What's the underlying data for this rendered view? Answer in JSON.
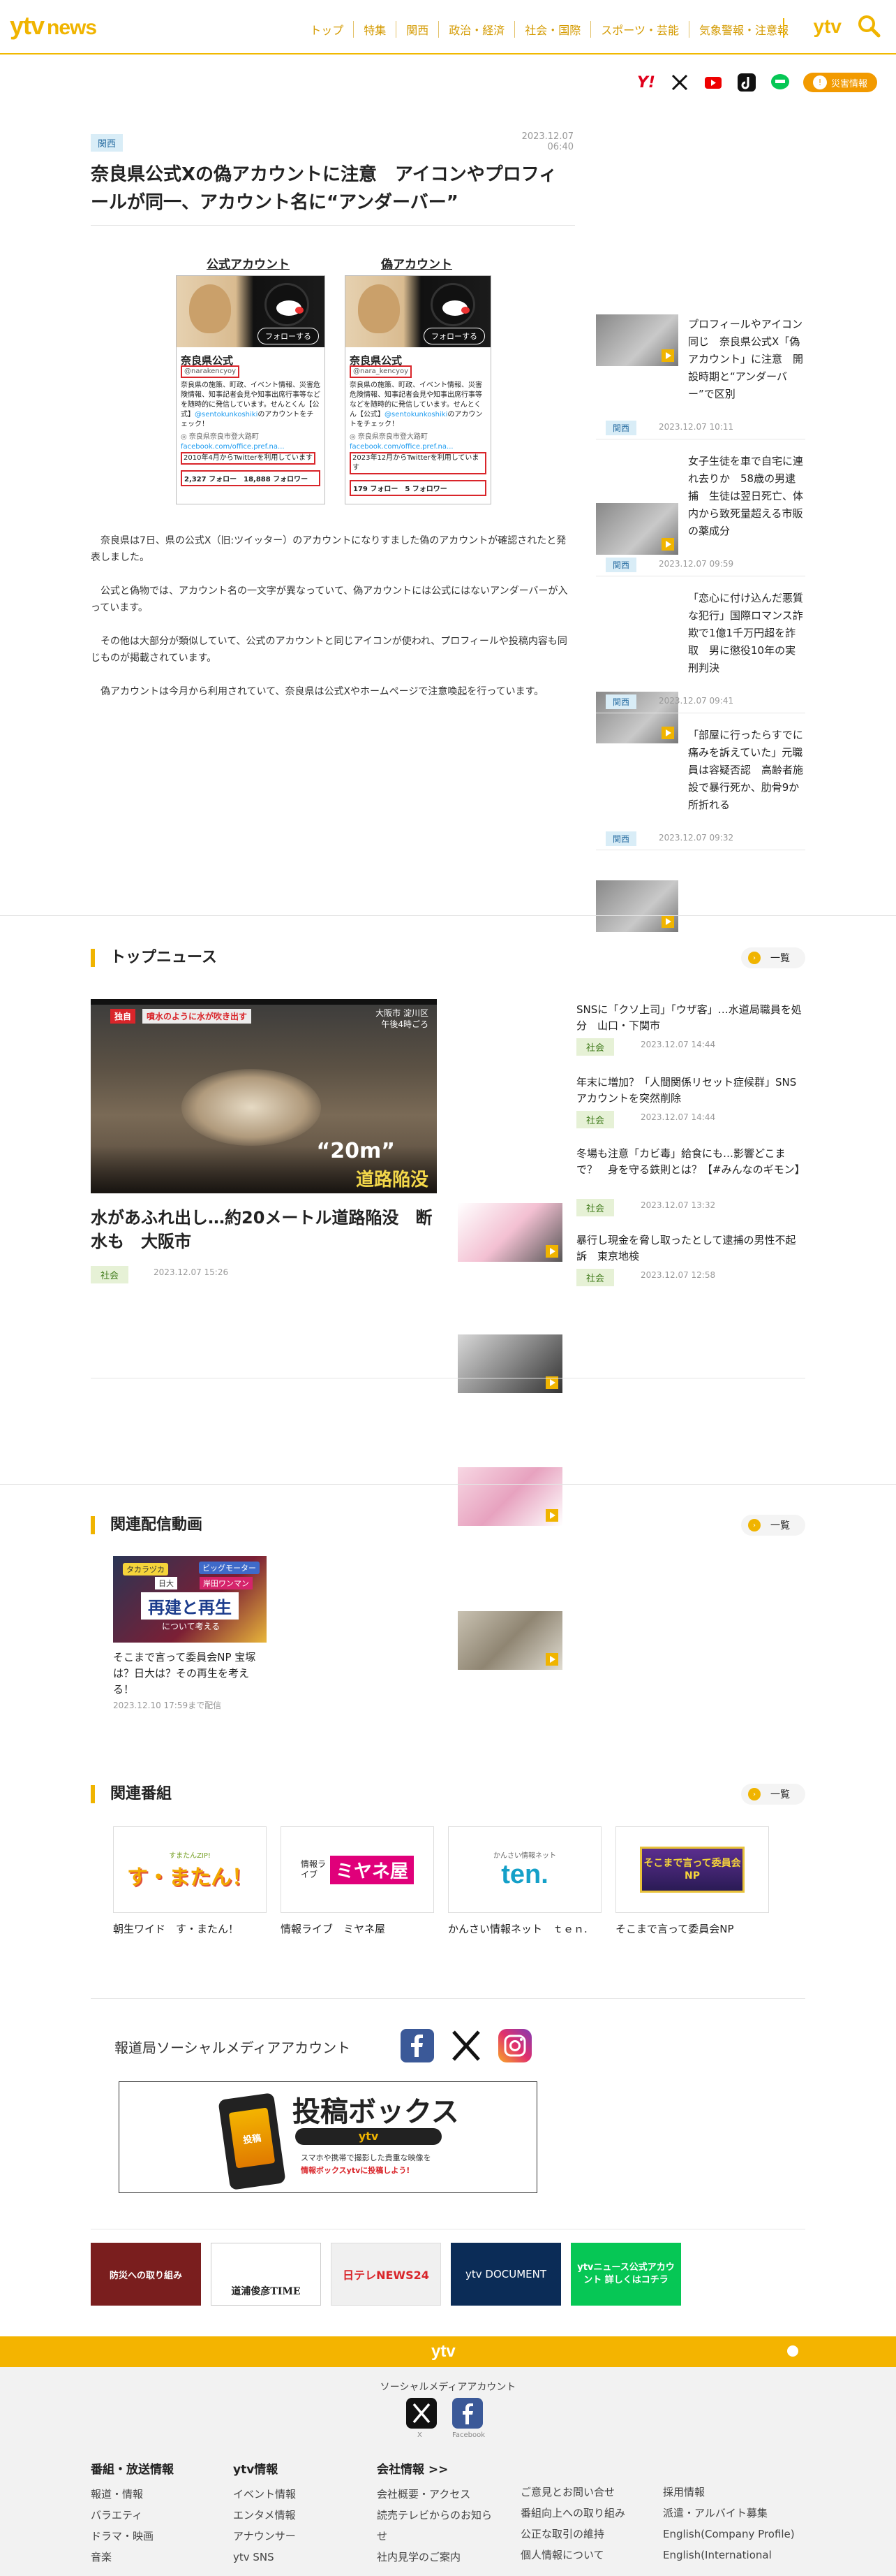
{
  "header": {
    "logo_main": "ytv",
    "logo_sub": "news",
    "nav": [
      "トップ",
      "特集",
      "関西",
      "政治・経済",
      "社会・国際",
      "スポーツ・芸能",
      "気象警報・注意報"
    ],
    "right_logo": "ytv"
  },
  "top_social": {
    "disaster_label": "災害情報",
    "icons": [
      "yahoo-icon",
      "x-icon",
      "youtube-icon",
      "tiktok-icon",
      "line-icon"
    ]
  },
  "article": {
    "category": "関西",
    "date": "2023.12.07 06:40",
    "title": "奈良県公式Xの偽アカウントに注意　アイコンやプロフィールが同一、アカウント名に“アンダーバー”",
    "figure": {
      "official_caption": "公式アカウント",
      "fake_caption": "偽アカウント",
      "follow": "フォローする",
      "account_name": "奈良県公式",
      "official_handle": "@narakencyoy",
      "fake_handle": "@nara_kencyoy",
      "bio": "奈良県の施策、町政、イベント情報、災害危険情報、知事記者会見や知事出席行事等などを随時的に発信しています。せんとくん【公式】",
      "bio_handle": "@sentokunkoshiki",
      "bio_tail": "のアカウントをチェック！",
      "location": "◎ 奈良県奈良市登大路町",
      "link": "facebook.com/office.pref.na...",
      "official_joined": "2010年4月からTwitterを利用しています",
      "fake_joined": "2023年12月からTwitterを利用しています",
      "official_stats": "2,327 フォロー　18,888 フォロワー",
      "fake_stats": "179 フォロー　5 フォロワー"
    },
    "paragraphs": [
      "奈良県は7日、県の公式X（旧:ツイッター）のアカウントになりすました偽のアカウントが確認されたと発表しました。",
      "公式と偽物では、アカウント名の一文字が異なっていて、偽アカウントには公式にはないアンダーバーが入っています。",
      "その他は大部分が類似していて、公式のアカウントと同じアイコンが使われ、プロフィールや投稿内容も同じものが掲載されています。",
      "偽アカウントは今月から利用されていて、奈良県は公式Xやホームページで注意喚起を行っています。"
    ]
  },
  "sidebar": [
    {
      "title": "プロフィールやアイコン同じ　奈良県公式X「偽アカウント」に注意　開設時期と“アンダーバー”で区別",
      "category": "関西",
      "date": "2023.12.07 10:11"
    },
    {
      "title": "女子生徒を車で自宅に連れ去りか　58歳の男逮捕　生徒は翌日死亡、体内から致死量超える市販の薬成分",
      "category": "関西",
      "date": "2023.12.07 09:59"
    },
    {
      "title": "「恋心に付け込んだ悪質な犯行」国際ロマンス詐欺で1億1千万円超を詐取　男に懲役10年の実刑判決",
      "category": "関西",
      "date": "2023.12.07 09:41"
    },
    {
      "title": "「部屋に行ったらすでに痛みを訴えていた」元職員は容疑否認　高齢者施設で暴行死か、肋骨9か所折れる",
      "category": "関西",
      "date": "2023.12.07 09:32"
    }
  ],
  "top_news": {
    "heading": "トップニュース",
    "more": "一覧",
    "main": {
      "title": "水があふれ出し…約20メートル道路陥没　断水も　大阪市",
      "category": "社会",
      "date": "2023.12.07 15:26",
      "overlay_tag": "独自",
      "overlay_line": "噴水のように水が吹き出す",
      "overlay_place": "大阪市 淀川区",
      "overlay_time": "午後4時ごろ",
      "overlay_big": "“20m”",
      "overlay_sub": "道路陥没"
    },
    "items": [
      {
        "title": "SNSに「クソ上司」「ウザ客」…水道局職員を処分　山口・下関市",
        "category": "社会",
        "date": "2023.12.07 14:44"
      },
      {
        "title": "年末に増加？「人間関係リセット症候群」SNSアカウントを突然削除",
        "category": "社会",
        "date": "2023.12.07 14:44"
      },
      {
        "title": "冬場も注意「カビ毒」給食にも…影響どこまで？　身を守る鉄則とは？【#みんなのギモン】",
        "category": "社会",
        "date": "2023.12.07 13:32"
      },
      {
        "title": "暴行し現金を脅し取ったとして逮捕の男性不起訴　東京地検",
        "category": "社会",
        "date": "2023.12.07 12:58"
      }
    ]
  },
  "related_video": {
    "heading": "関連配信動画",
    "more": "一覧",
    "item": {
      "title": "そこまで言って委員会NP 宝塚は？日大は？その再生を考える！",
      "date": "2023.12.10 17:59まで配信",
      "thumb_tag1": "タカラヅカ",
      "thumb_tag2": "ビッグモーター",
      "thumb_tag3": "日大",
      "thumb_tag4": "岸田ワンマン",
      "thumb_main": "再建と再生",
      "thumb_sub": "について考える"
    }
  },
  "related_programs": {
    "heading": "関連番組",
    "more": "一覧",
    "items": [
      {
        "name": "朝生ワイド　す・またん！",
        "logo": "す・またん！",
        "logo_small": "すまたんZIP!"
      },
      {
        "name": "情報ライブ　ミヤネ屋",
        "logo": "ミヤネ屋",
        "logo_small": "情報ライブ"
      },
      {
        "name": "かんさい情報ネット　ｔｅｎ.",
        "logo": "ten.",
        "logo_small": "かんさい情報ネット"
      },
      {
        "name": "そこまで言って委員会NP",
        "logo": "そこまで言って委員会NP",
        "logo_small": ""
      }
    ]
  },
  "social_accounts": {
    "label": "報道局ソーシャルメディアアカウント",
    "toko_title": "投稿ボックス",
    "toko_ytv": "ytv",
    "toko_line1": "スマホや携帯で撮影した貴重な映像を",
    "toko_line2": "情報ボックスytvに投稿しよう!",
    "toko_phone": "投稿"
  },
  "banners": [
    {
      "label": "防災への取り組み",
      "color": "#7a1e1e"
    },
    {
      "label": "道浦俊彦TIME",
      "color": "#ffffff"
    },
    {
      "label": "日テレNEWS24",
      "color": "#f0f0f0"
    },
    {
      "label": "ytv DOCUMENT",
      "color": "#0b2c57"
    },
    {
      "label": "ytvニュース公式アカウント 詳しくはコチラ",
      "color": "#06c755"
    }
  ],
  "footer": {
    "logo": "ytv",
    "sns_label": "ソーシャルメディアアカウント",
    "sns_x": "X",
    "sns_fb": "Facebook",
    "columns": [
      {
        "heading": "番組・放送情報",
        "links": [
          "報道・情報",
          "バラエティ",
          "ドラマ・映画",
          "音楽"
        ]
      },
      {
        "heading": "ytv情報",
        "links": [
          "イベント情報",
          "エンタメ情報",
          "アナウンサー",
          "ytv SNS"
        ]
      },
      {
        "heading": "会社情報 >>",
        "links": [
          "会社概要・アクセス",
          "読売テレビからのお知らせ",
          "社内見学のご案内"
        ]
      },
      {
        "heading": "",
        "links": [
          "ご意見とお問い合せ",
          "番組向上への取り組み",
          "公正な取引の維持",
          "個人情報について"
        ]
      },
      {
        "heading": "",
        "links": [
          "採用情報",
          "派遣・アルバイト募集",
          "English(Company Profile)",
          "English(International"
        ]
      }
    ]
  }
}
